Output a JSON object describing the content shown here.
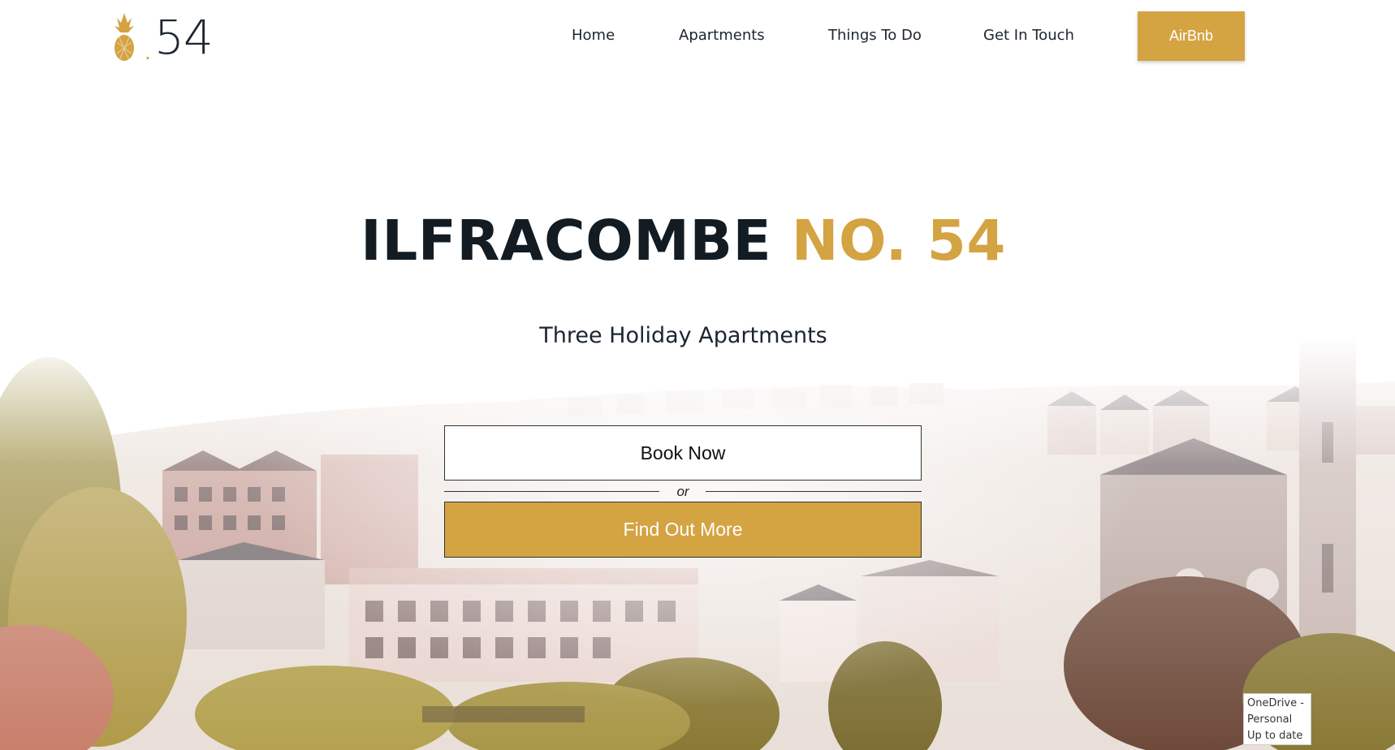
{
  "logo": {
    "icon": "pineapple-icon",
    "dot": ".",
    "number": "54"
  },
  "nav": {
    "items": [
      {
        "label": "Home"
      },
      {
        "label": "Apartments"
      },
      {
        "label": "Things To Do"
      },
      {
        "label": "Get In Touch"
      }
    ],
    "cta_label": "AirBnb"
  },
  "hero": {
    "title_main": "ILFRACOMBE",
    "title_accent": "NO. 54",
    "subtitle": "Three Holiday Apartments",
    "book_label": "Book Now",
    "or_label": "or",
    "more_label": "Find Out More"
  },
  "toast": {
    "line1": "OneDrive -",
    "line2": "Personal",
    "line3": "Up to date"
  },
  "colors": {
    "accent": "#d4a342",
    "text_dark": "#131b23",
    "background": "#ffffff"
  }
}
